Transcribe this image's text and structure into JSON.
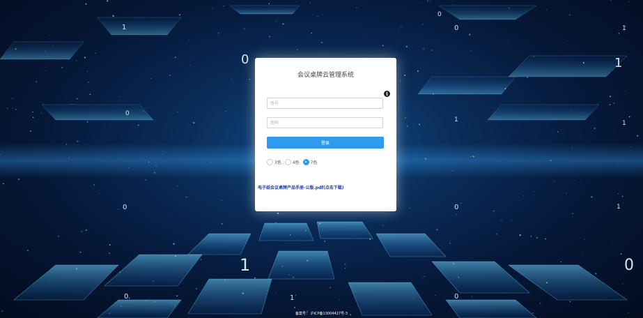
{
  "app": {
    "title": "会议桌牌云管理系统"
  },
  "login": {
    "account_placeholder": "账号",
    "password_placeholder": "密码",
    "submit_label": "登录",
    "info_icon": "info-icon"
  },
  "color_options": [
    {
      "label": "3色",
      "checked": false
    },
    {
      "label": "4色",
      "checked": false
    },
    {
      "label": "7色",
      "checked": true
    }
  ],
  "manual_link": {
    "text": "电子纸会议桌牌产品手册-公版.pdf(点击下载)"
  },
  "footer": {
    "icp": "备案号： 沪ICP备13004427号-3"
  },
  "background_digits": [
    "1",
    "0",
    "1",
    "0",
    "1",
    "0",
    "0",
    "1",
    "1",
    "0",
    "0",
    "1",
    "1",
    "0",
    "0",
    "1",
    "0"
  ],
  "colors": {
    "accent": "#2f9bf0",
    "link": "#1c3fa6",
    "background_dark": "#06193a"
  }
}
